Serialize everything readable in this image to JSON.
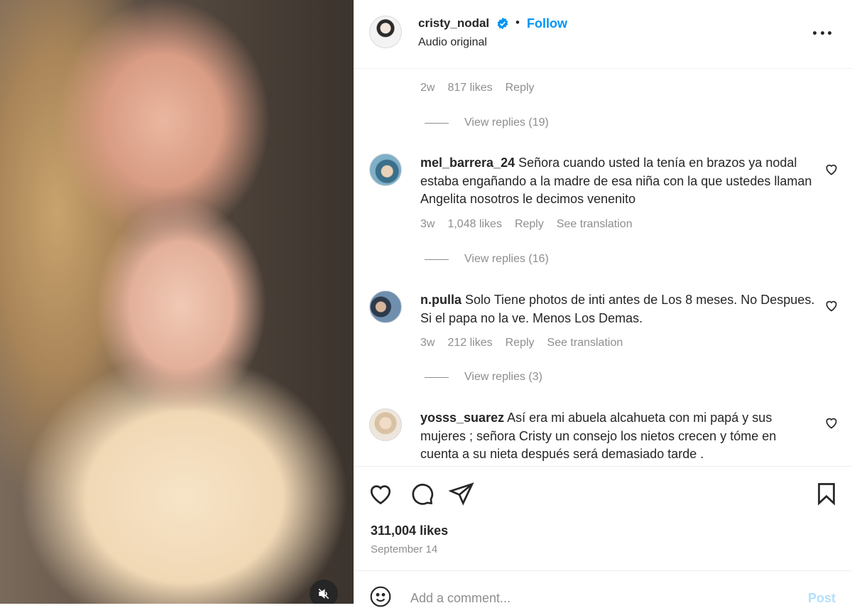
{
  "header": {
    "username": "cristy_nodal",
    "separator": "•",
    "follow_label": "Follow",
    "audio_label": "Audio original"
  },
  "top_comment_meta": {
    "age": "2w",
    "likes": "817 likes",
    "reply": "Reply"
  },
  "top_replies": "View replies (19)",
  "comments": [
    {
      "username": "mel_barrera_24",
      "text": "Señora cuando usted la tenía en brazos ya nodal estaba engañando a la madre de esa niña con la que ustedes llaman Angelita nosotros le decimos venenito",
      "age": "3w",
      "likes": "1,048 likes",
      "reply": "Reply",
      "translate": "See translation",
      "replies": "View replies (16)"
    },
    {
      "username": "n.pulla",
      "text": "Solo Tiene photos de inti antes de Los 8 meses. No Despues. Si el papa no la ve. Menos Los Demas.",
      "age": "3w",
      "likes": "212 likes",
      "reply": "Reply",
      "translate": "See translation",
      "replies": "View replies (3)"
    },
    {
      "username": "yosss_suarez",
      "text": "Así era mi abuela alcahueta con mi papá y sus mujeres ; señora Cristy un consejo los nietos crecen y tóme en cuenta a su nieta después será demasiado tarde ."
    }
  ],
  "post": {
    "likes": "311,004 likes",
    "date": "September 14",
    "add_comment_placeholder": "Add a comment...",
    "post_label": "Post"
  },
  "colors": {
    "accent": "#0095f6",
    "muted": "#8e8e8e",
    "text": "#262626",
    "post_disabled": "#b2dffc"
  },
  "icons": [
    "verified-icon",
    "more-options-icon",
    "heart-icon",
    "comment-icon",
    "share-icon",
    "bookmark-icon",
    "mute-icon",
    "emoji-icon"
  ]
}
